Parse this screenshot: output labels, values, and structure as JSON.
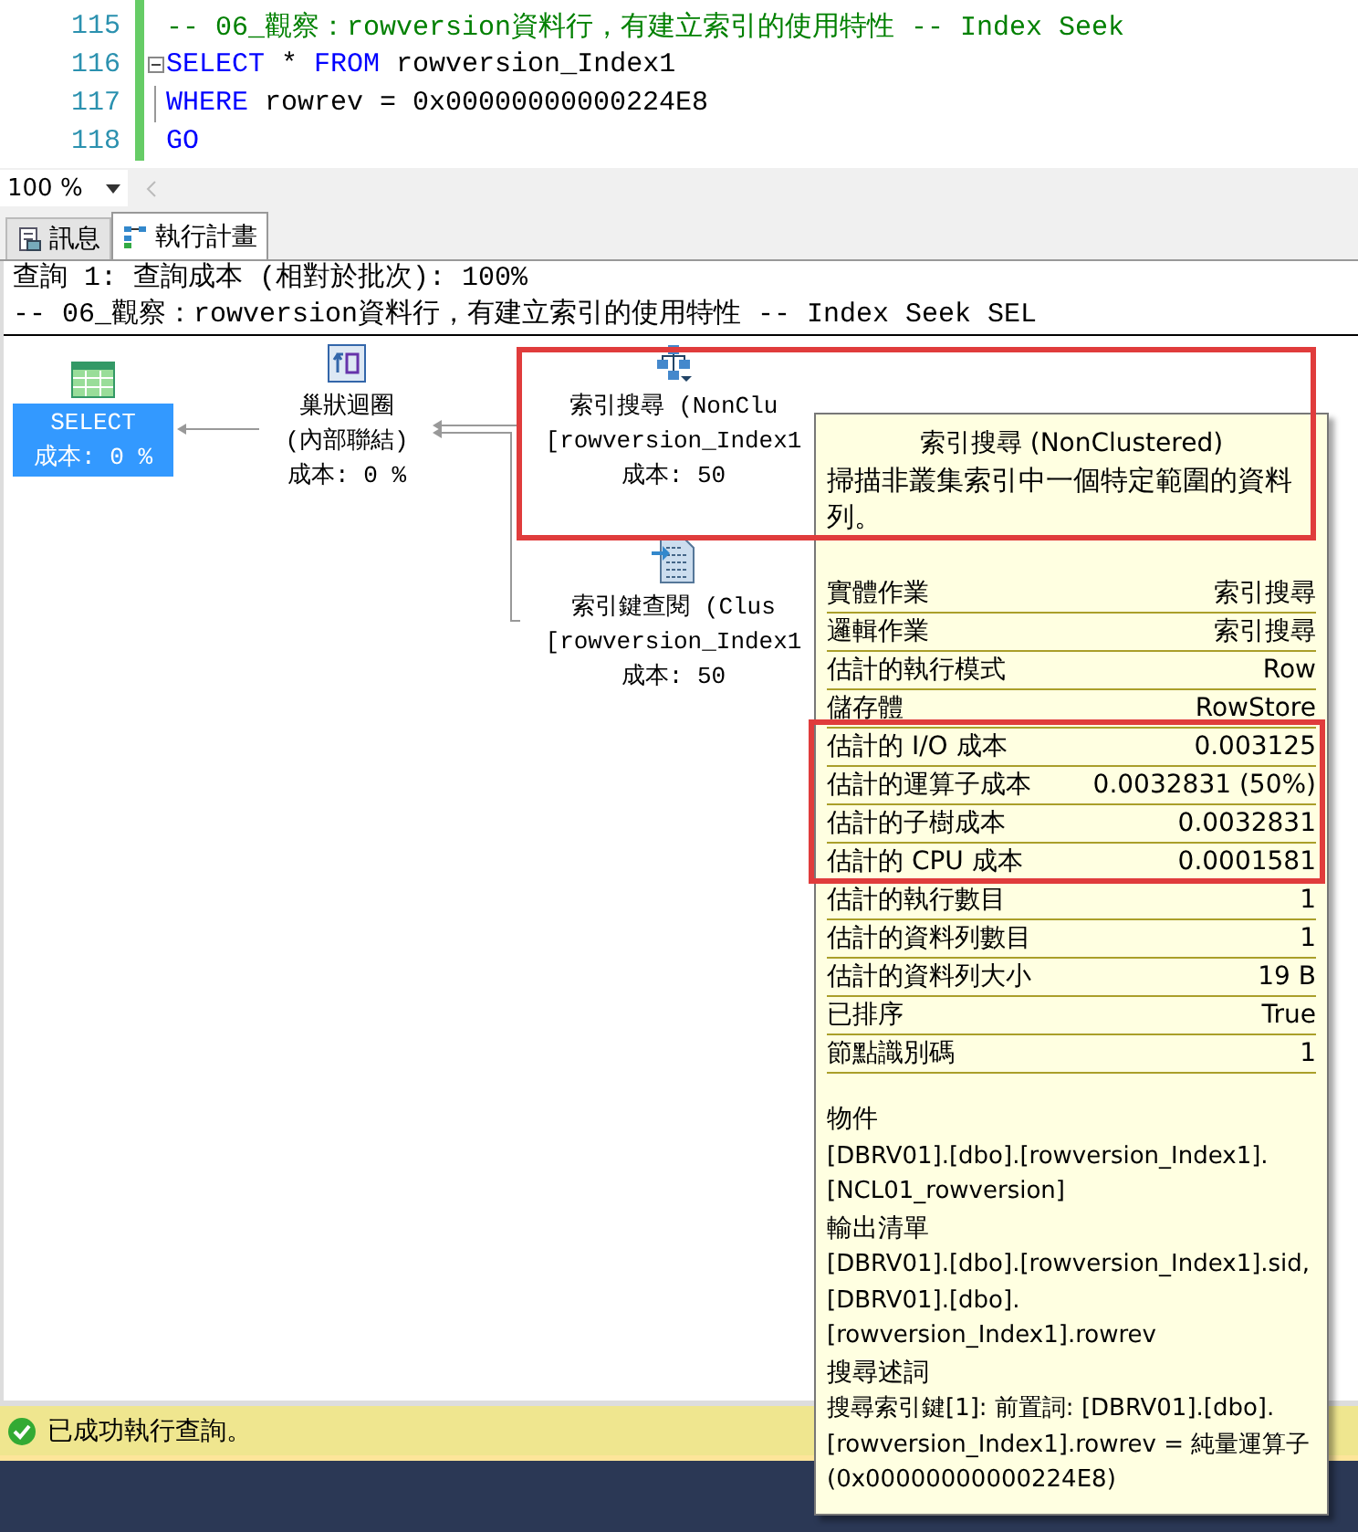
{
  "editor": {
    "lines": [
      {
        "number": "115",
        "kind": "plain",
        "tokens": [
          {
            "kind": "comment",
            "text": "-- 06_觀察：rowversion資料行，有建立索引的使用特性 -- Index Seek"
          }
        ]
      },
      {
        "number": "116",
        "kind": "fold_start",
        "tokens": [
          {
            "kind": "keyword",
            "text": "SELECT"
          },
          {
            "kind": "plain",
            "text": " * "
          },
          {
            "kind": "keyword",
            "text": "FROM"
          },
          {
            "kind": "plain",
            "text": " rowversion_Index1"
          }
        ]
      },
      {
        "number": "117",
        "kind": "fold_inner",
        "tokens": [
          {
            "kind": "keyword",
            "text": "WHERE"
          },
          {
            "kind": "plain",
            "text": " rowrev = 0x00000000000224E8"
          }
        ]
      },
      {
        "number": "118",
        "kind": "plain",
        "tokens": [
          {
            "kind": "keyword",
            "text": "GO"
          }
        ]
      }
    ]
  },
  "zoom": {
    "value": "100 %"
  },
  "tabs": [
    {
      "label": "訊息",
      "kind": "messages",
      "selected": false
    },
    {
      "label": "執行計畫",
      "kind": "plan",
      "selected": true
    }
  ],
  "plan": {
    "header": [
      "查詢 1: 查詢成本 (相對於批次): 100%",
      "-- 06_觀察：rowversion資料行，有建立索引的使用特性 -- Index Seek SEL"
    ],
    "nodes": [
      {
        "kind": "select",
        "selected": true,
        "lines": [
          "SELECT",
          "成本: 0 %"
        ]
      },
      {
        "kind": "nested_loops",
        "selected": false,
        "lines": [
          "巢狀迴圈",
          "(內部聯結)",
          "成本: 0 %"
        ]
      },
      {
        "kind": "index_seek",
        "selected": false,
        "lines": [
          "索引搜尋 (NonClu",
          "[rowversion_Index1",
          "成本: 50"
        ]
      },
      {
        "kind": "key_lookup",
        "selected": false,
        "lines": [
          "索引鍵查閱 (Clus",
          "[rowversion_Index1",
          "成本: 50"
        ]
      }
    ]
  },
  "tooltip": {
    "title": "索引搜尋 (NonClustered)",
    "description": "掃描非叢集索引中一個特定範圍的資料列。",
    "rows": [
      {
        "name": "實體作業",
        "value": "索引搜尋"
      },
      {
        "name": "邏輯作業",
        "value": "索引搜尋"
      },
      {
        "name": "估計的執行模式",
        "value": "Row"
      },
      {
        "name": "儲存體",
        "value": "RowStore"
      },
      {
        "name": "估計的 I/O 成本",
        "value": "0.003125"
      },
      {
        "name": "估計的運算子成本",
        "value": "0.0032831 (50%)"
      },
      {
        "name": "估計的子樹成本",
        "value": "0.0032831"
      },
      {
        "name": "估計的 CPU 成本",
        "value": "0.0001581"
      },
      {
        "name": "估計的執行數目",
        "value": "1"
      },
      {
        "name": "估計的資料列數目",
        "value": "1"
      },
      {
        "name": "估計的資料列大小",
        "value": "19 B"
      },
      {
        "name": "已排序",
        "value": "True"
      },
      {
        "name": "節點識別碼",
        "value": "1"
      }
    ],
    "sections": [
      {
        "heading": "物件",
        "text": "[DBRV01].[dbo].[rowversion_Index1].[NCL01_rowversion]"
      },
      {
        "heading": "輸出清單",
        "text": "[DBRV01].[dbo].[rowversion_Index1].sid, [DBRV01].[dbo].[rowversion_Index1].rowrev"
      },
      {
        "heading": "搜尋述詞",
        "text": "搜尋索引鍵[1]: 前置詞: [DBRV01].[dbo].[rowversion_Index1].rowrev = 純量運算子(0x00000000000224E8)"
      }
    ]
  },
  "status_bar": {
    "text": "已成功執行查詢。"
  }
}
